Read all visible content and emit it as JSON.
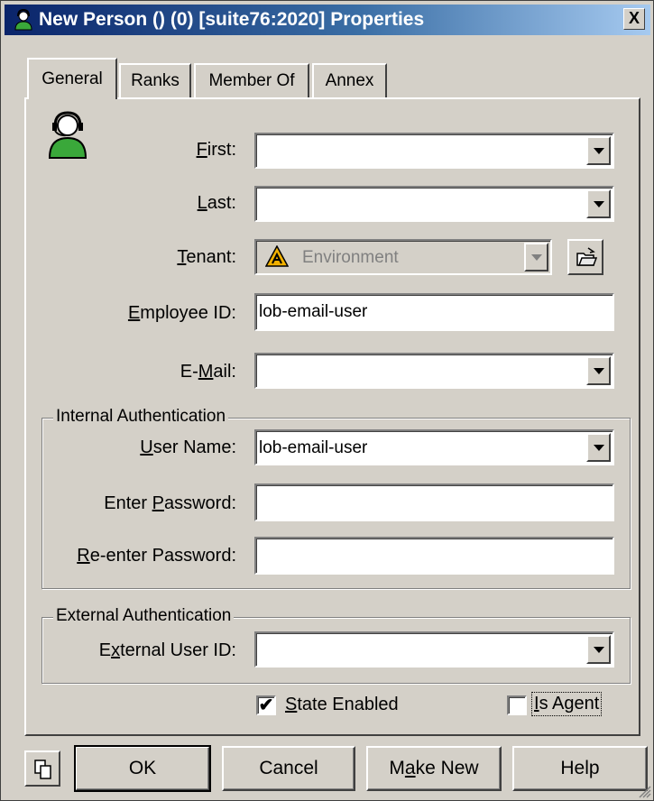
{
  "window": {
    "title": "New Person () (0) [suite76:2020] Properties",
    "close_label": "X"
  },
  "tabs": [
    {
      "label": "General",
      "active": true
    },
    {
      "label": "Ranks",
      "active": false
    },
    {
      "label": "Member Of",
      "active": false
    },
    {
      "label": "Annex",
      "active": false
    }
  ],
  "general": {
    "first": {
      "label_pre": "",
      "label_u": "F",
      "label_post": "irst:",
      "value": ""
    },
    "last": {
      "label_pre": "",
      "label_u": "L",
      "label_post": "ast:",
      "value": ""
    },
    "tenant": {
      "label_pre": "",
      "label_u": "T",
      "label_post": "enant:",
      "value": "Environment",
      "icon": "warning-triangle-icon"
    },
    "employee_id": {
      "label_pre": "",
      "label_u": "E",
      "label_post": "mployee ID:",
      "value": "lob-email-user"
    },
    "email": {
      "label_pre": "E-",
      "label_u": "M",
      "label_post": "ail:",
      "value": ""
    }
  },
  "internal_auth": {
    "title": "Internal Authentication",
    "user_name": {
      "label_pre": "",
      "label_u": "U",
      "label_post": "ser Name:",
      "value": "lob-email-user"
    },
    "password": {
      "label_pre": "Enter ",
      "label_u": "P",
      "label_post": "assword:",
      "value": ""
    },
    "reenter": {
      "label_pre": "",
      "label_u": "R",
      "label_post": "e-enter Password:",
      "value": ""
    }
  },
  "external_auth": {
    "title": "External Authentication",
    "user_id": {
      "label_pre": "E",
      "label_u": "x",
      "label_post": "ternal User ID:",
      "value": ""
    }
  },
  "checkboxes": {
    "state_enabled": {
      "label_u": "S",
      "label_post": "tate Enabled",
      "checked_mark": "✔"
    },
    "is_agent": {
      "label_u": "I",
      "label_post": "s Agent",
      "checked_mark": ""
    }
  },
  "buttons": {
    "ok": "OK",
    "cancel": "Cancel",
    "make_new_pre": "M",
    "make_new_u": "a",
    "make_new_post": "ke New",
    "help": "Help"
  },
  "colors": {
    "dialog_bg": "#d4d0c8",
    "title_start": "#0a246a",
    "title_end": "#a6caf0",
    "person_icon": "#3aa83a"
  }
}
